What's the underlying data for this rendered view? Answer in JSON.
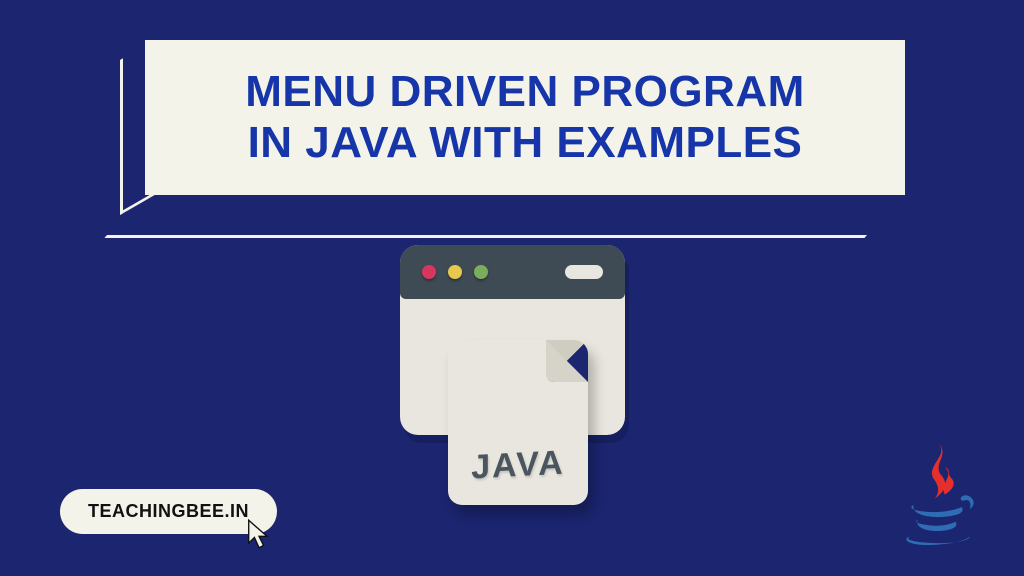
{
  "title": {
    "line1": "MENU DRIVEN PROGRAM",
    "line2": "IN JAVA WITH EXAMPLES"
  },
  "illustration": {
    "file_label": "JAVA"
  },
  "badge": {
    "text": "TEACHINGBEE.IN"
  },
  "colors": {
    "background": "#1b2570",
    "title_bg": "#f3f3ea",
    "title_text": "#1635a8",
    "logo_blue": "#2e6db4",
    "logo_red": "#e3302d"
  }
}
